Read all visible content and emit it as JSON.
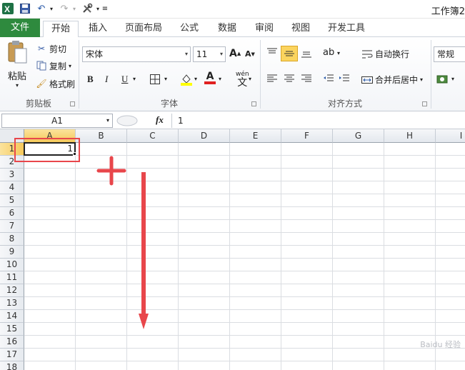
{
  "window": {
    "title": "工作簿2"
  },
  "tabs": {
    "file": "文件",
    "home": "开始",
    "insert": "插入",
    "layout": "页面布局",
    "formulas": "公式",
    "data": "数据",
    "review": "审阅",
    "view": "视图",
    "developer": "开发工具"
  },
  "clipboard": {
    "paste": "粘贴",
    "cut": "剪切",
    "copy": "复制",
    "format_painter": "格式刷",
    "label": "剪贴板"
  },
  "font": {
    "name": "宋体",
    "size": "11",
    "bold": "B",
    "italic": "I",
    "underline": "U",
    "phonetic": "wén",
    "label": "字体"
  },
  "alignment": {
    "wrap": "自动换行",
    "merge": "合并后居中",
    "label": "对齐方式"
  },
  "number": {
    "format": "常规"
  },
  "formula_bar": {
    "name_box": "A1",
    "fx": "fx",
    "value": "1"
  },
  "sheet": {
    "columns": [
      "A",
      "B",
      "C",
      "D",
      "E",
      "F",
      "G",
      "H",
      "I"
    ],
    "rows": [
      "1",
      "2",
      "3",
      "4",
      "5",
      "6",
      "7",
      "8",
      "9",
      "10",
      "11",
      "12",
      "13",
      "14",
      "15",
      "16",
      "17",
      "18"
    ],
    "a1_value": "1"
  },
  "colors": {
    "file_tab": "#2e8a3e",
    "highlight": "#e8464b",
    "selected_header": "#f5c85a"
  },
  "watermark": "Baidu 经验"
}
